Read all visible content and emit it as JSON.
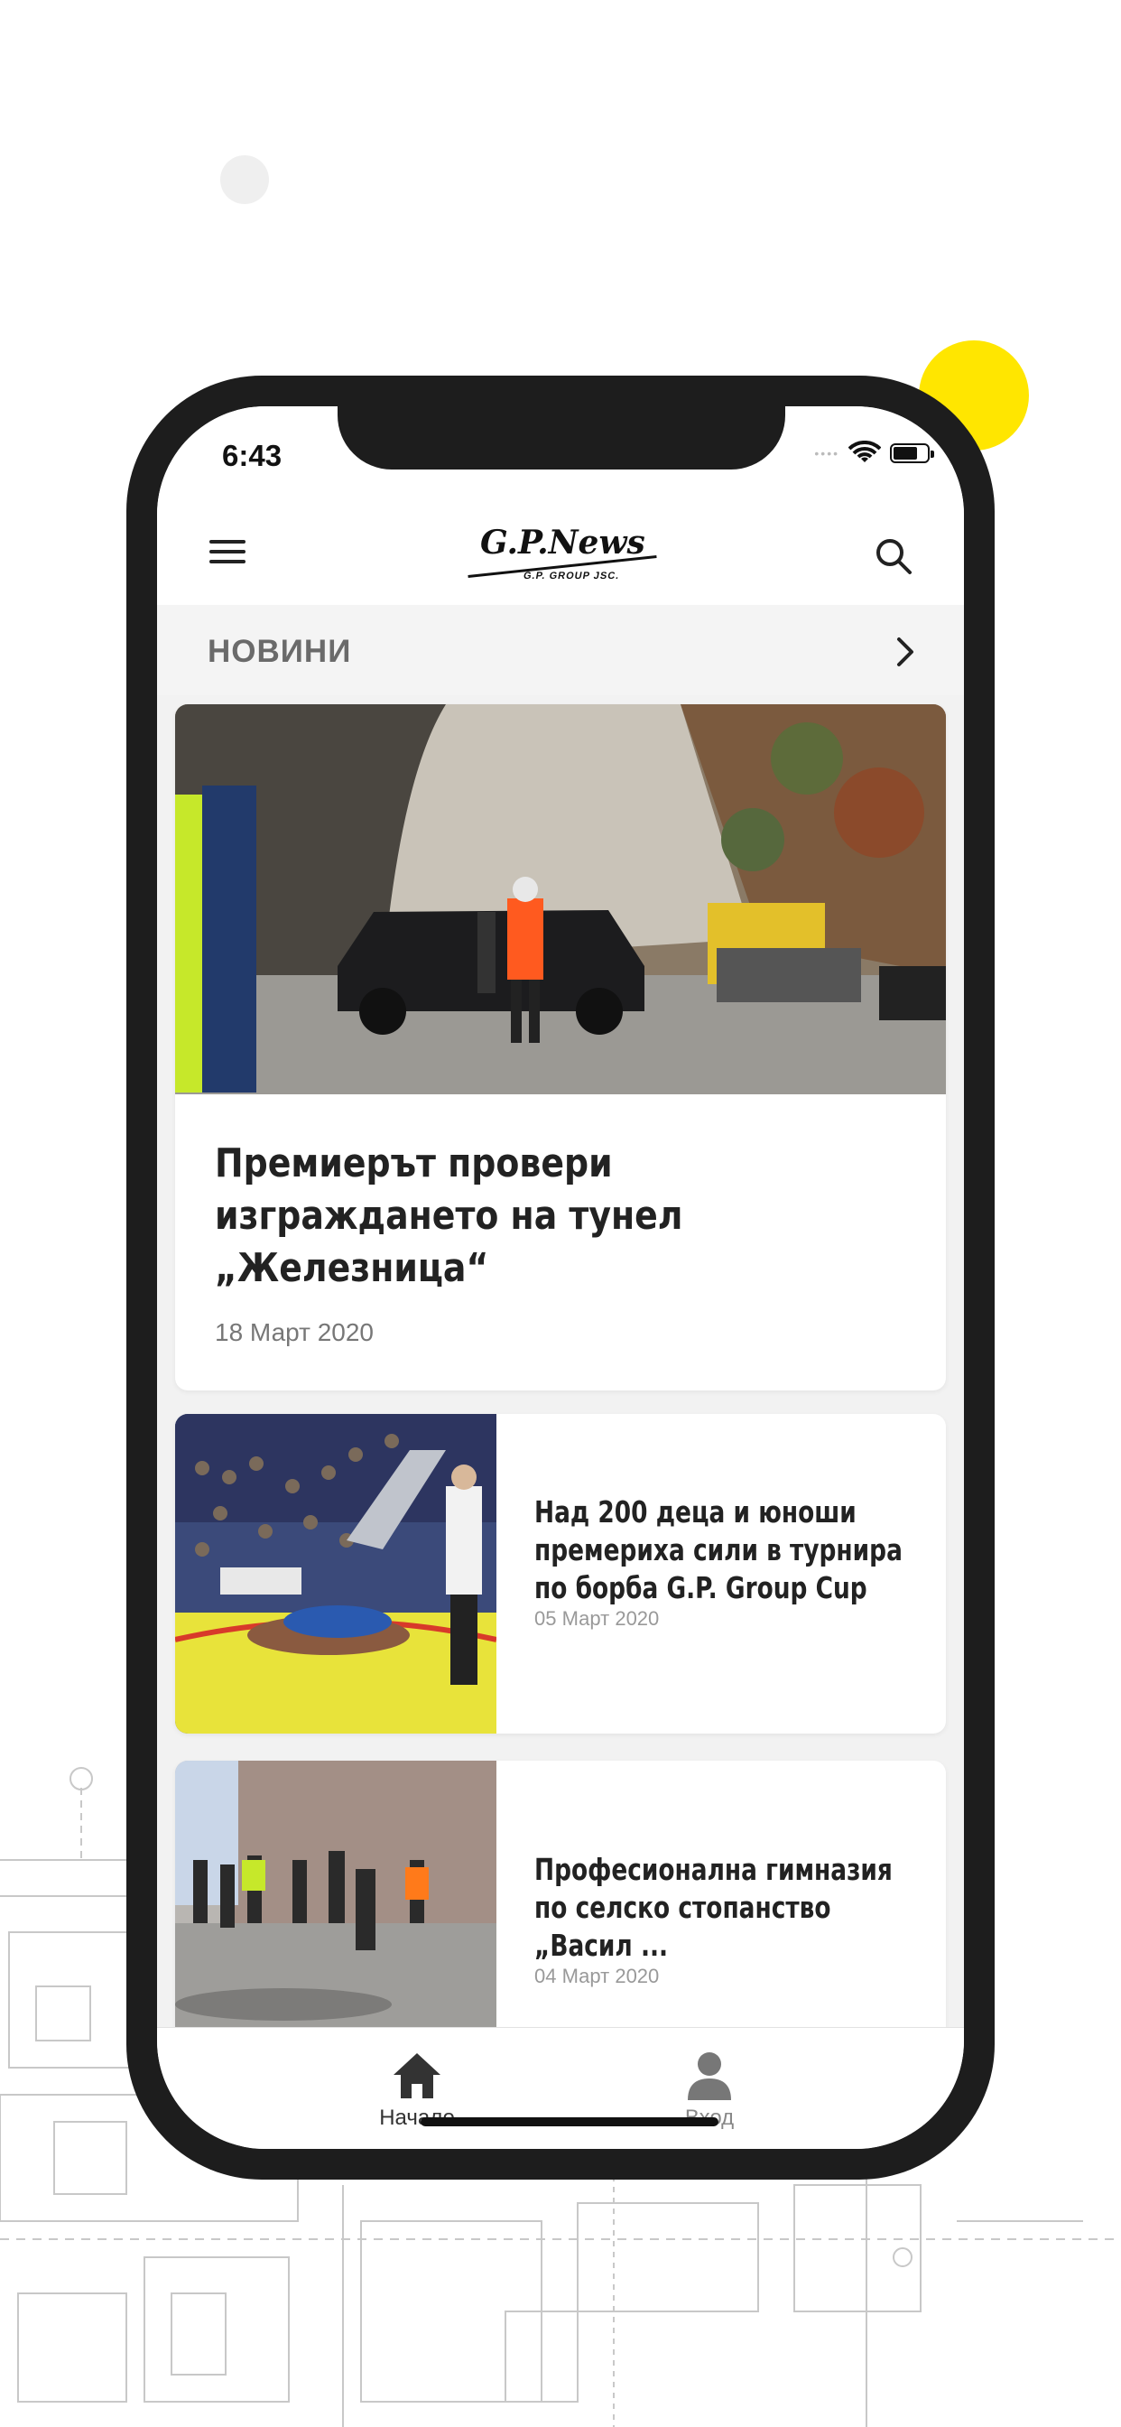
{
  "status": {
    "time": "6:43"
  },
  "app": {
    "logo": "G.P.News",
    "logo_sub": "G.P. GROUP JSC."
  },
  "section": {
    "title": "НОВИНИ"
  },
  "articles": [
    {
      "title": "Премиерът провери изграждането на тунел „Железница“",
      "date": "18 Март 2020"
    },
    {
      "title": "Над 200 деца и юноши премериха сили в турнира по борба G.P. Group Cup",
      "date": "05 Март 2020"
    },
    {
      "title": "Професионална гимназия по селско стопанство „Васил ...",
      "date": "04 Март 2020"
    }
  ],
  "tabs": {
    "home": "Начало",
    "login": "Вход"
  },
  "colors": {
    "accent_yellow": "#ffe600",
    "phone_frame": "#1d1d1d"
  },
  "icons": [
    "menu-icon",
    "search-icon",
    "chevron-right-icon",
    "home-icon",
    "user-icon",
    "wifi-icon",
    "battery-icon"
  ]
}
